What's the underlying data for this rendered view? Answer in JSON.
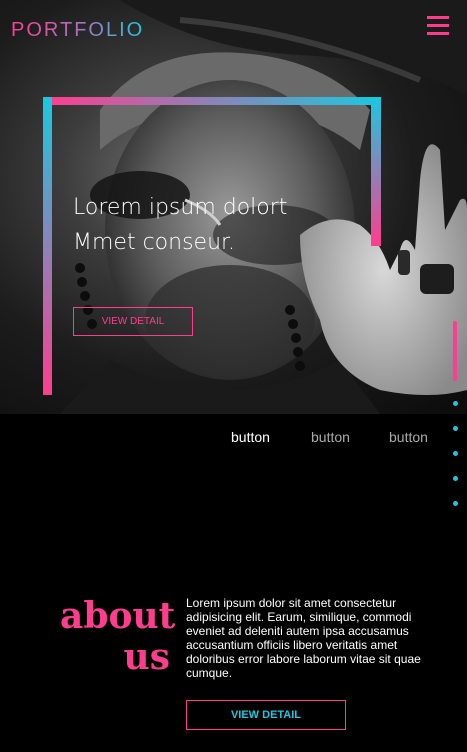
{
  "header": {
    "logo_text": "PORTFOLIO",
    "menu_icon": "hamburger-menu-icon"
  },
  "hero": {
    "title_line1": "Lorem ipsum dolort",
    "title_line2": "Mmet conseur.",
    "button_label": "VIEW DETAIL",
    "photo": "black-and-white portrait of man in hat lowering sunglasses"
  },
  "slider": {
    "dot_count": 5
  },
  "tabs": [
    {
      "label": "button",
      "active": true
    },
    {
      "label": "button",
      "active": false
    },
    {
      "label": "button",
      "active": false
    }
  ],
  "about": {
    "title_line1": "about",
    "title_line2": "us",
    "body": "Lorem ipsum dolor sit amet consectetur adipisicing elit. Earum, similique, commodi eveniet ad deleniti autem ipsa accusamus accusantium officiis libero veritatis amet doloribus error labore laborum vitae sit quae cumque.",
    "button_label": "VIEW DETAIL"
  },
  "colors": {
    "accent_pink": "#ff3d8e",
    "accent_cyan": "#19c9e0",
    "background": "#000000"
  }
}
